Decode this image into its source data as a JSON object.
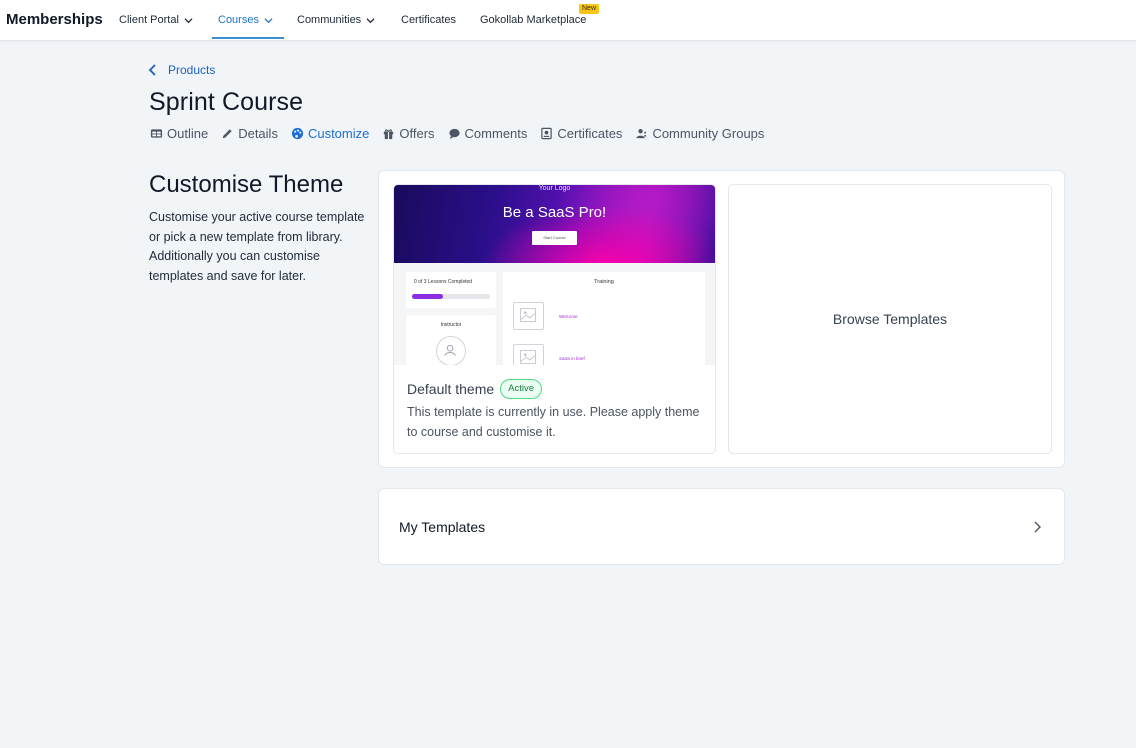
{
  "nav": {
    "brand": "Memberships",
    "items": [
      {
        "label": "Client Portal"
      },
      {
        "label": "Courses"
      },
      {
        "label": "Communities"
      },
      {
        "label": "Certificates"
      },
      {
        "label": "Gokollab Marketplace"
      }
    ],
    "new_badge": "New",
    "active_color": "#1d76c2"
  },
  "breadcrumb": {
    "back_label": "Products"
  },
  "page": {
    "title": "Sprint Course"
  },
  "tabs": [
    {
      "label": "Outline",
      "icon": "table-icon"
    },
    {
      "label": "Details",
      "icon": "pencil-icon"
    },
    {
      "label": "Customize",
      "icon": "palette-icon",
      "active": true
    },
    {
      "label": "Offers",
      "icon": "gift-icon"
    },
    {
      "label": "Comments",
      "icon": "chat-bubble-icon"
    },
    {
      "label": "Certificates",
      "icon": "certificate-icon"
    },
    {
      "label": "Community Groups",
      "icon": "users-icon"
    }
  ],
  "intro": {
    "title": "Customise Theme",
    "description": "Customise your active course template or pick a new template from library. Additionally you can customise templates and save for later."
  },
  "theme_card": {
    "preview": {
      "logo": "Your Logo",
      "hero_title": "Be a SaaS Pro!",
      "hero_button": "Start Course",
      "progress_label": "0 of 3 Lessons Completed",
      "progress_value": 0.4,
      "instructor_label": "Instructor",
      "training_label": "Training",
      "lessons": [
        "Welcome",
        "SaaS in brief"
      ]
    },
    "name": "Default theme",
    "status": "Active",
    "description": "This template is currently in use. Please apply theme to course and customise it."
  },
  "browse": {
    "label": "Browse Templates"
  },
  "my_templates": {
    "label": "My Templates"
  }
}
